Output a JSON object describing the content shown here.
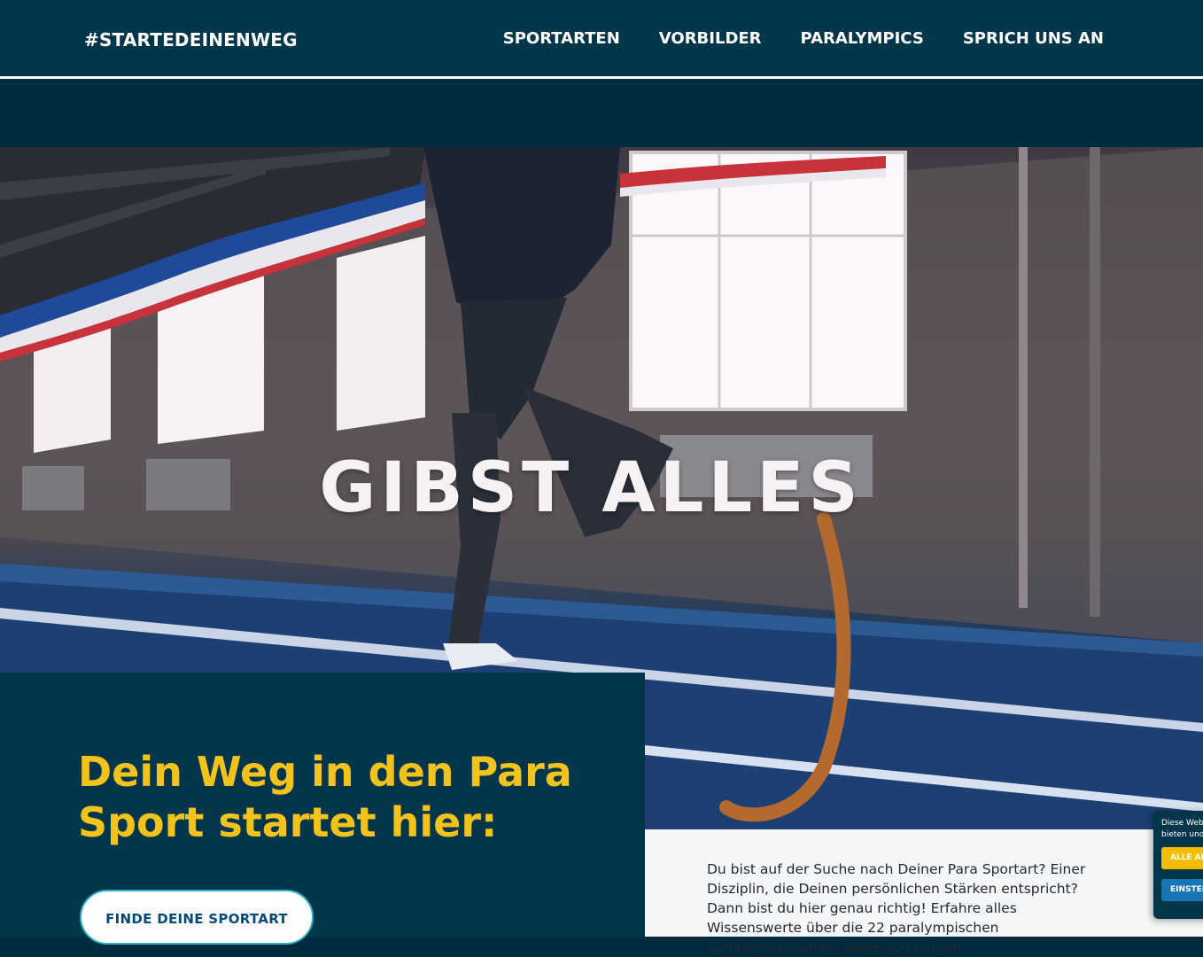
{
  "header": {
    "brand": "#STARTEDEINENWEG",
    "nav": [
      "SPORTARTEN",
      "VORBILDER",
      "PARALYMPICS",
      "SPRICH UNS AN"
    ]
  },
  "hero": {
    "title": "GIBST ALLES"
  },
  "intro": {
    "heading": "Dein Weg in den Para Sport startet hier:",
    "cta_label": "FINDE DEINE SPORTART"
  },
  "text_panel": {
    "paragraph": "Du bist auf der Suche nach Deiner Para Sportart? Einer Disziplin, die Deinen persönlichen Stärken entspricht? Dann bist du hier genau richtig! Erfahre alles Wissenswerte über die 22 paralympischen Sommersportarten, lerne von deinen"
  },
  "cookie_banner": {
    "text_line1": "Diese Webs",
    "text_line2": "bieten und c",
    "accept_label": "ALLE AK",
    "settings_label": "EINSTEL"
  },
  "colors": {
    "header_bg": "#04364b",
    "accent_yellow": "#f3c31d",
    "cta_border": "#2ab3c6",
    "cookie_accept": "#f5bd00",
    "cookie_settings": "#1677b7"
  }
}
